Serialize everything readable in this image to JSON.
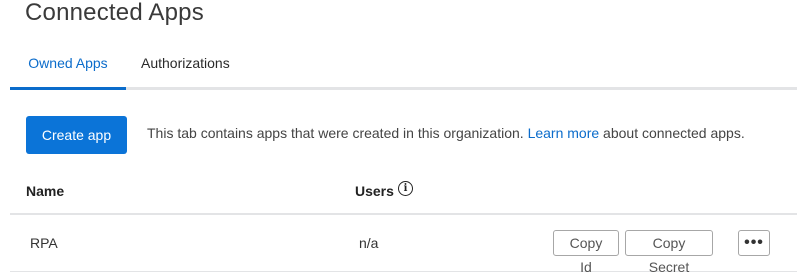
{
  "header": {
    "title": "Connected Apps"
  },
  "tabs": [
    {
      "label": "Owned Apps",
      "active": true
    },
    {
      "label": "Authorizations",
      "active": false
    }
  ],
  "toolbar": {
    "create_label": "Create app",
    "info_prefix": "This tab contains apps that were created in this organization.",
    "learn_more": "Learn more",
    "info_suffix": "about connected apps."
  },
  "table": {
    "columns": {
      "name": "Name",
      "users": "Users"
    },
    "users_info_icon": "info-icon",
    "rows": [
      {
        "name": "RPA",
        "users": "n/a",
        "copy_id_label": "Copy Id",
        "copy_secret_label": "Copy Secret",
        "more_label": "•••"
      }
    ]
  },
  "colors": {
    "accent": "#0b6ccb",
    "button_primary": "#0b74d8",
    "divider": "#e3e4e6"
  }
}
